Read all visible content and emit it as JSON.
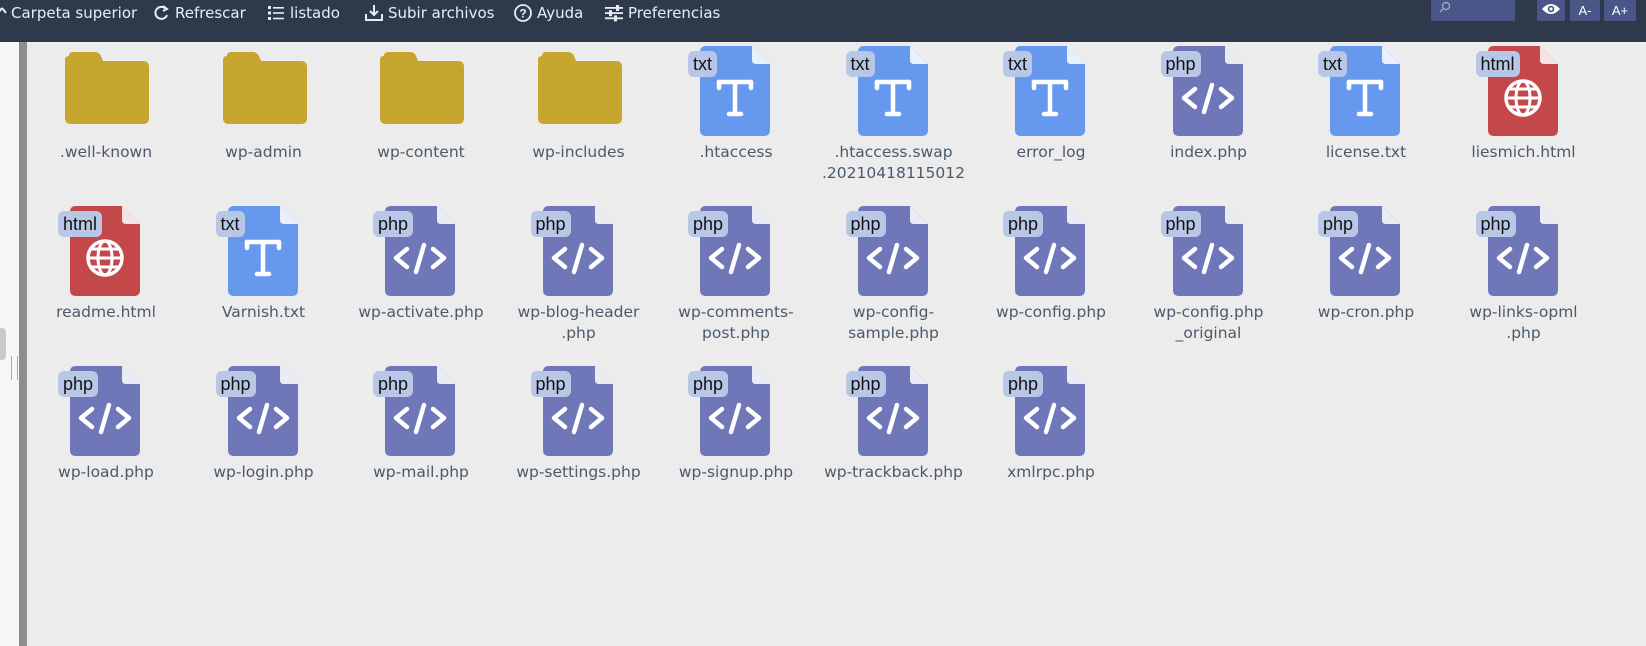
{
  "toolbar": {
    "parent": "Carpeta superior",
    "refresh": "Refrescar",
    "list": "listado",
    "upload": "Subir archivos",
    "help": "Ayuda",
    "prefs": "Preferencias",
    "search_placeholder": "",
    "font_smaller": "A-",
    "font_larger": "A+"
  },
  "colors": {
    "folder": "#c6a62f",
    "txt": "#6699ee",
    "php": "#6f77b8",
    "html": "#c4484a",
    "badge": "#b9c7e6",
    "toolbar": "#2e3a4c"
  },
  "items": [
    {
      "name": ".well-known",
      "type": "folder"
    },
    {
      "name": "wp-admin",
      "type": "folder"
    },
    {
      "name": "wp-content",
      "type": "folder"
    },
    {
      "name": "wp-includes",
      "type": "folder"
    },
    {
      "name": ".htaccess",
      "type": "txt",
      "badge": "txt"
    },
    {
      "name": ".htaccess.swap\n.20210418115012",
      "type": "txt",
      "badge": "txt"
    },
    {
      "name": "error_log",
      "type": "txt",
      "badge": "txt"
    },
    {
      "name": "index.php",
      "type": "php",
      "badge": "php"
    },
    {
      "name": "license.txt",
      "type": "txt",
      "badge": "txt"
    },
    {
      "name": "liesmich.html",
      "type": "html",
      "badge": "html"
    },
    {
      "name": "readme.html",
      "type": "html",
      "badge": "html"
    },
    {
      "name": "Varnish.txt",
      "type": "txt",
      "badge": "txt"
    },
    {
      "name": "wp-activate.php",
      "type": "php",
      "badge": "php"
    },
    {
      "name": "wp-blog-header\n.php",
      "type": "php",
      "badge": "php"
    },
    {
      "name": "wp-comments-\npost.php",
      "type": "php",
      "badge": "php"
    },
    {
      "name": "wp-config-\nsample.php",
      "type": "php",
      "badge": "php"
    },
    {
      "name": "wp-config.php",
      "type": "php",
      "badge": "php"
    },
    {
      "name": "wp-config.php\n_original",
      "type": "php",
      "badge": "php"
    },
    {
      "name": "wp-cron.php",
      "type": "php",
      "badge": "php"
    },
    {
      "name": "wp-links-opml\n.php",
      "type": "php",
      "badge": "php"
    },
    {
      "name": "wp-load.php",
      "type": "php",
      "badge": "php"
    },
    {
      "name": "wp-login.php",
      "type": "php",
      "badge": "php"
    },
    {
      "name": "wp-mail.php",
      "type": "php",
      "badge": "php"
    },
    {
      "name": "wp-settings.php",
      "type": "php",
      "badge": "php"
    },
    {
      "name": "wp-signup.php",
      "type": "php",
      "badge": "php"
    },
    {
      "name": "wp-trackback.php",
      "type": "php",
      "badge": "php"
    },
    {
      "name": "xmlrpc.php",
      "type": "php",
      "badge": "php"
    }
  ]
}
